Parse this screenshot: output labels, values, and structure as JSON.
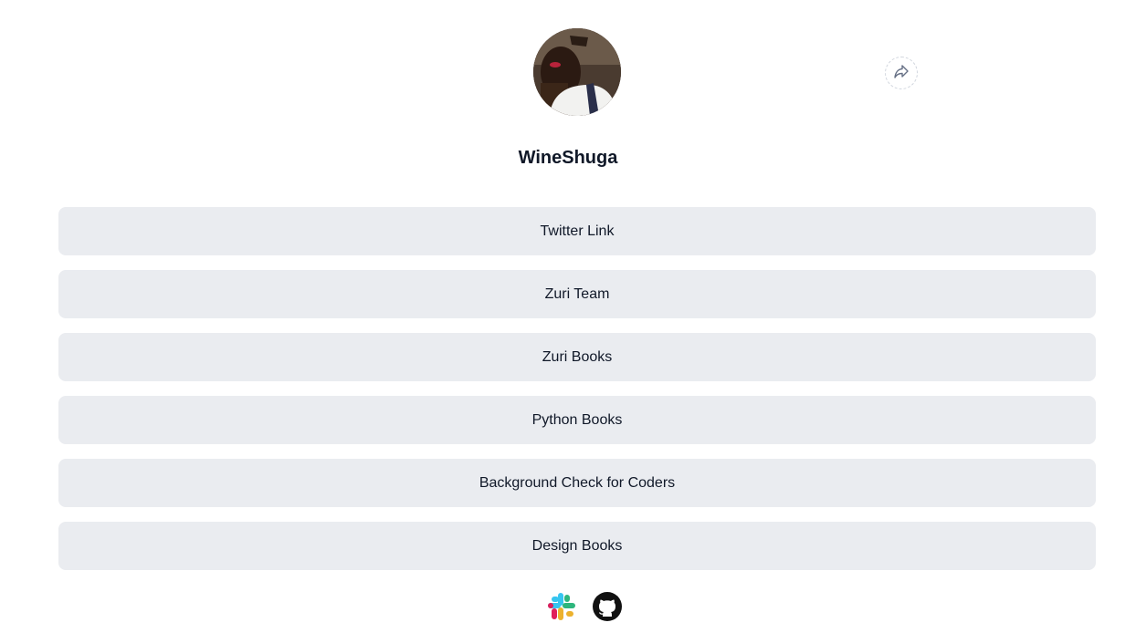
{
  "profile": {
    "name": "WineShuga",
    "avatar_icon": "profile-photo"
  },
  "share": {
    "icon": "share-arrow-icon"
  },
  "links": [
    {
      "label": "Twitter Link"
    },
    {
      "label": "Zuri Team"
    },
    {
      "label": "Zuri Books"
    },
    {
      "label": "Python Books"
    },
    {
      "label": "Background Check for Coders"
    },
    {
      "label": "Design Books"
    }
  ],
  "footer": {
    "icons": [
      "slack-icon",
      "github-icon"
    ]
  },
  "colors": {
    "link_background": "#eaecf0",
    "text": "#101828"
  }
}
